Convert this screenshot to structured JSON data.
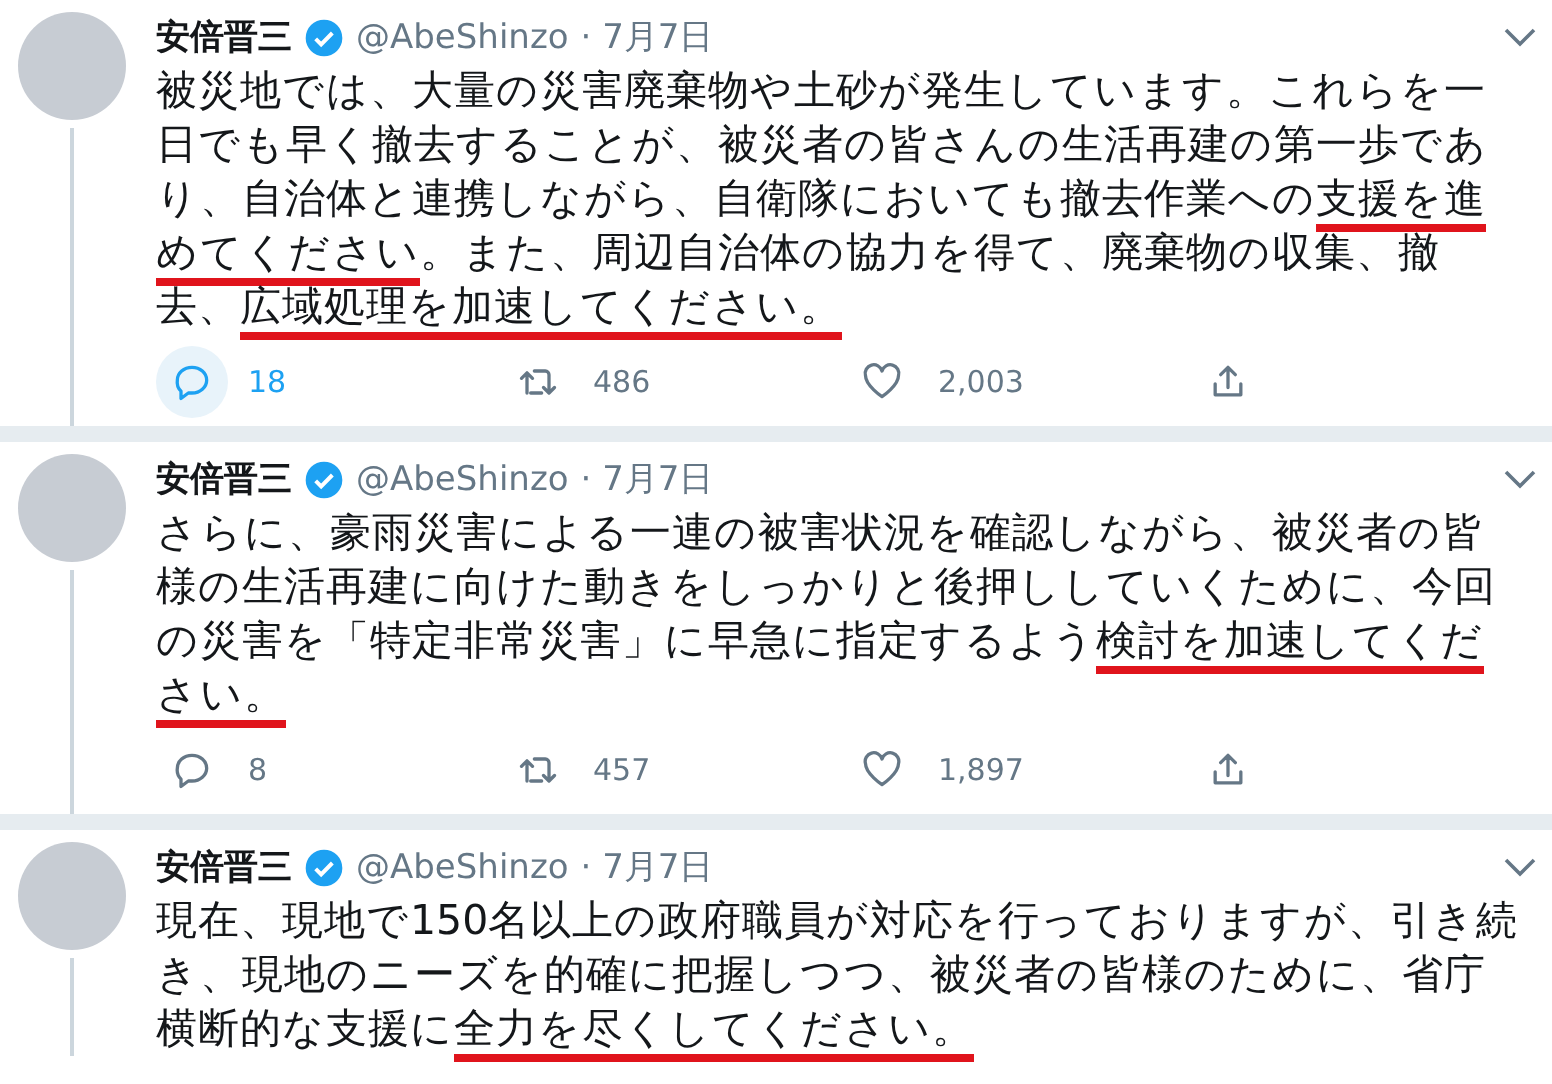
{
  "tweets": [
    {
      "name": "安倍晋三",
      "verified": true,
      "handle": "@AbeShinzo",
      "date": "· 7月7日",
      "segments": [
        {
          "text": "被災地では、大量の災害廃棄物や土砂が発生しています。これらを一日でも早く撤去することが、被災者の皆さんの生活再建の第一歩であり、自治体と連携しながら、自衛隊においても撤去作業への",
          "underlined": false
        },
        {
          "text": "支援を進めてください",
          "underlined": true
        },
        {
          "text": "。また、周辺自治体の協力を得て、廃棄物の収集、撤去、",
          "underlined": false
        },
        {
          "text": "広域処理を加速してください。",
          "underlined": true
        }
      ],
      "actions": [
        {
          "kind": "reply",
          "count": "18",
          "highlighted": true
        },
        {
          "kind": "retweet",
          "count": "486",
          "highlighted": false
        },
        {
          "kind": "like",
          "count": "2,003",
          "highlighted": false
        },
        {
          "kind": "share",
          "highlighted": false
        }
      ]
    },
    {
      "name": "安倍晋三",
      "verified": true,
      "handle": "@AbeShinzo",
      "date": "· 7月7日",
      "segments": [
        {
          "text": "さらに、豪雨災害による一連の被害状況を確認しながら、被災者の皆様の生活再建に向けた動きをしっかりと後押ししていくために、今回の災害を「特定非常災害」に早急に指定するよう",
          "underlined": false
        },
        {
          "text": "検討を加速してください。",
          "underlined": true
        }
      ],
      "actions": [
        {
          "kind": "reply",
          "count": "8",
          "highlighted": false
        },
        {
          "kind": "retweet",
          "count": "457",
          "highlighted": false
        },
        {
          "kind": "like",
          "count": "1,897",
          "highlighted": false
        },
        {
          "kind": "share",
          "highlighted": false
        }
      ]
    },
    {
      "name": "安倍晋三",
      "verified": true,
      "handle": "@AbeShinzo",
      "date": "· 7月7日",
      "segments": [
        {
          "text": "現在、現地で150名以上の政府職員が対応を行っておりますが、引き続き、現地のニーズを的確に把握しつつ、被災者の皆様のために、省庁横断的な支援に",
          "underlined": false
        },
        {
          "text": "全力を尽くしてください。",
          "underlined": true
        }
      ]
    }
  ]
}
